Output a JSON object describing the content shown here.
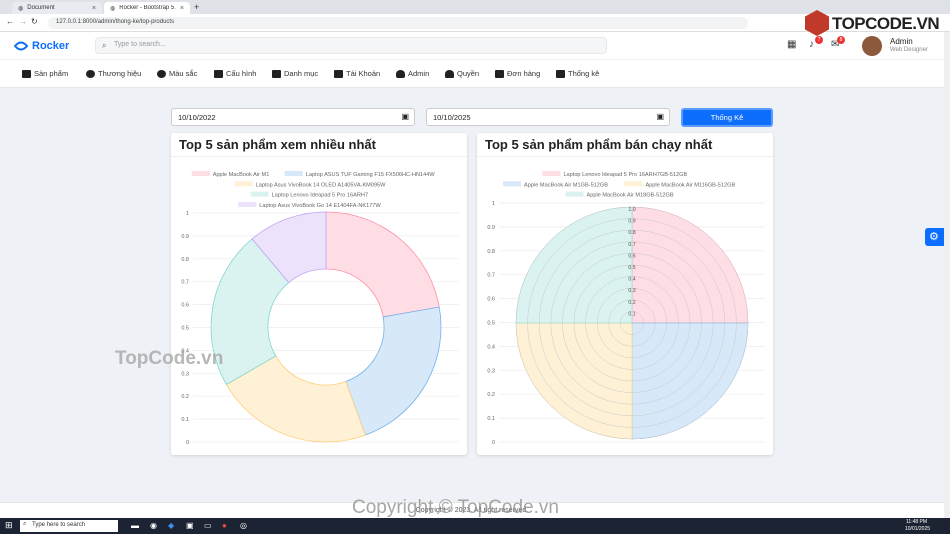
{
  "browser": {
    "tabs": [
      "Document",
      "Rocker - Bootstrap 5 Admin Da"
    ],
    "url": "127.0.0.1:8000/admin/thong-ke/top-products"
  },
  "header": {
    "brand": "Rocker",
    "search_placeholder": "Type to search...",
    "notification_count": "7",
    "message_count": "8",
    "user_name": "Admin",
    "user_role": "Web Designer"
  },
  "watermark_logo": "TOPCODE.VN",
  "menu": [
    "Sản phẩm",
    "Thương hiệu",
    "Màu sắc",
    "Cấu hình",
    "Danh mục",
    "Tài Khoản",
    "Admin",
    "Quyền",
    "Đơn hàng",
    "Thống kê"
  ],
  "filters": {
    "from_date": "10/10/2022",
    "to_date": "10/10/2025",
    "submit_label": "Thống Kê"
  },
  "colors": {
    "accent": "#0d6efd",
    "pink": "#ffdde4",
    "blue": "#d7e9f9",
    "yellow": "#fff1d6",
    "teal": "#daf3f1",
    "purple": "#ece2fb"
  },
  "chart_data": [
    {
      "type": "doughnut",
      "title": "Top 5 sản phẩm xem nhiều nhất",
      "categories": [
        "Apple MacBook Air M1",
        "Laptop ASUS TUF Gaming F15 FX506HC-HN144W",
        "Laptop Asus VivoBook 14 OLED A1405VA-KM095W",
        "Laptop Lenovo Ideapad 5 Pro 16ARH7",
        "Laptop Asus VivoBook Go 14 E1404FA-NK177W"
      ],
      "values": [
        1,
        1,
        1,
        1,
        0.5
      ],
      "y_ticks": [
        "1",
        "0.9",
        "0.8",
        "0.7",
        "0.6",
        "0.5",
        "0.4",
        "0.3",
        "0.2",
        "0.1",
        "0"
      ],
      "grid": true
    },
    {
      "type": "polarArea",
      "title": "Top 5 sản phẩm phẩm bán chạy nhất",
      "categories": [
        "Laptop Lenovo Ideapad 5 Pro 16ARH7GB-512GB",
        "Apple MacBook Air M1GB-512GB",
        "Apple MacBook Air M116GB-512GB",
        "Apple MacBook Air M18GB-512GB"
      ],
      "values": [
        1,
        1,
        1,
        1
      ],
      "y_ticks": [
        "1",
        "0.9",
        "0.8",
        "0.7",
        "0.6",
        "0.5",
        "0.4",
        "0.3",
        "0.2",
        "0.1",
        "0"
      ],
      "r_ticks": [
        "1.0",
        "0.9",
        "0.8",
        "0.7",
        "0.6",
        "0.5",
        "0.4",
        "0.3",
        "0.2",
        "0.1"
      ],
      "grid": true
    }
  ],
  "footer": "Copyright © 2023. All right reserved.",
  "watermark_text": "TopCode.vn",
  "watermark_copyright": "Copyright © TopCode.vn",
  "taskbar": {
    "search_placeholder": "Type here to search",
    "time": "11:48 PM",
    "date": "10/01/2025"
  }
}
